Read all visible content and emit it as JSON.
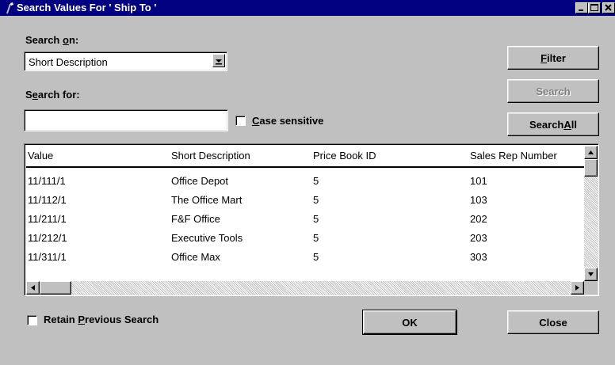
{
  "window": {
    "title": "Search Values For ' Ship To '"
  },
  "search_on": {
    "label_pre": "Search ",
    "label_hotkey": "o",
    "label_post": "n:",
    "selected": "Short Description"
  },
  "search_for": {
    "label_pre": "S",
    "label_hotkey": "e",
    "label_post": "arch for:",
    "value": ""
  },
  "case_sensitive": {
    "label_hotkey": "C",
    "label_post": "ase sensitive",
    "checked": false
  },
  "buttons": {
    "filter_hotkey": "F",
    "filter_post": "ilter",
    "search": "Search",
    "search_all_pre": "Search ",
    "search_all_hotkey": "A",
    "search_all_post": "ll",
    "ok": "OK",
    "close": "Close"
  },
  "results": {
    "columns": [
      "Value",
      "Short Description",
      "Price Book ID",
      "Sales Rep Number"
    ],
    "rows": [
      [
        "11/111/1",
        "Office Depot",
        "5",
        "101"
      ],
      [
        "11/112/1",
        "The Office Mart",
        "5",
        "103"
      ],
      [
        "11/211/1",
        "F&F Office",
        "5",
        "202"
      ],
      [
        "11/212/1",
        "Executive Tools",
        "5",
        "203"
      ],
      [
        "11/311/1",
        "Office Max",
        "5",
        "303"
      ]
    ]
  },
  "retain": {
    "label_pre": "Retain ",
    "label_hotkey": "P",
    "label_post": "revious Search",
    "checked": false
  }
}
